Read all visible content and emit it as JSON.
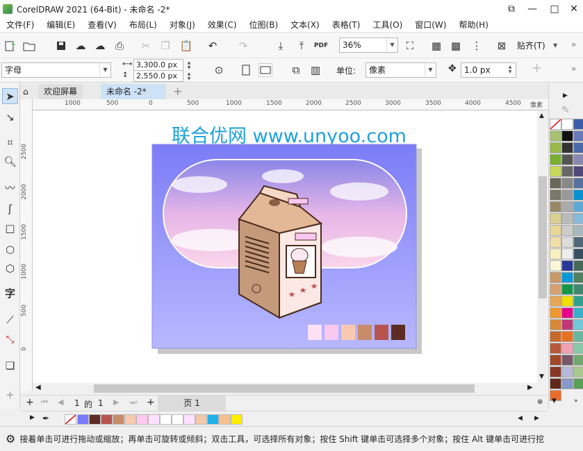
{
  "window": {
    "title": "CorelDRAW 2021 (64-Bit) - 未命名 -2*",
    "minimize": "—",
    "maximize": "□",
    "close": "✕",
    "restore": "⧉"
  },
  "menu": [
    "文件(F)",
    "编辑(E)",
    "查看(V)",
    "布局(L)",
    "对象(J)",
    "效果(C)",
    "位图(B)",
    "文本(X)",
    "表格(T)",
    "工具(O)",
    "窗口(W)",
    "帮助(H)"
  ],
  "toolbar": {
    "zoom": "36%",
    "pdf_label": "PDF",
    "snap_label": "贴齐(T)"
  },
  "propbar": {
    "object_type": "字母",
    "width": "3,300.0 px",
    "height": "2,550.0 px",
    "unit_label": "单位:",
    "unit_value": "像素",
    "nudge": "1.0 px"
  },
  "tabs": {
    "welcome": "欢迎屏幕",
    "doc": "未命名 -2*"
  },
  "ruler": {
    "h_labels": [
      "1000",
      "500",
      "0",
      "500",
      "1000",
      "1500",
      "2000",
      "2500",
      "3000",
      "3500",
      "4000",
      "4500"
    ],
    "unit": "像素",
    "v_labels": [
      "2500",
      "2000",
      "1500",
      "1000",
      "500",
      "0"
    ]
  },
  "canvas": {
    "watermark": "联合优网 www.unyoo.com"
  },
  "pagenav": {
    "current": "1",
    "of": "的",
    "total": "1",
    "page_tab": "页 1"
  },
  "doc_palette": [
    "#7b7bff",
    "#5c2d22",
    "#b85450",
    "#c88c6a",
    "#f8c8b0",
    "#ffc8f0",
    "#ffe0ff",
    "#ffffff",
    "#ffffff",
    "#ffe0ff",
    "#f0c8a8",
    "#20b0e8",
    "#f8c090",
    "#ffee00"
  ],
  "right_palette": [
    "#ffffff",
    "#3b5ca8",
    "#a8c070",
    "#111111",
    "#6878b8",
    "#98b848",
    "#333333",
    "#4868a8",
    "#78b030",
    "#555555",
    "#8888b0",
    "#c8d858",
    "#666666",
    "#504878",
    "#686858",
    "#888888",
    "#5870a0",
    "#787868",
    "#999999",
    "#0890d0",
    "#988868",
    "#aaaaaa",
    "#60a8d8",
    "#d8d090",
    "#bbbbbb",
    "#88b8d8",
    "#e8d898",
    "#cccccc",
    "#a8b8c0",
    "#f0e0a8",
    "#dddddd",
    "#506878",
    "#f8f0c0",
    "#eeeeee",
    "#385060",
    "#f8f8d8",
    "#283898",
    "#486858",
    "#c89868",
    "#0898d8",
    "#508060",
    "#d8a070",
    "#109848",
    "#408870",
    "#e8a858",
    "#f0e000",
    "#30a090",
    "#f09830",
    "#e8008a",
    "#38b0c8",
    "#d88838",
    "#c03878",
    "#70c8d8",
    "#c86828",
    "#e87020",
    "#68b8a0",
    "#b85838",
    "#f0a0b0",
    "#88c8a8",
    "#a04828",
    "#785868",
    "#70a870",
    "#883828",
    "#b8b8d8",
    "#a8c890",
    "#602818",
    "#8898c8",
    "#58a058",
    "#ec6c2c"
  ],
  "status": "接着单击可进行拖动或缩放；再单击可旋转或倾斜；双击工具，可选择所有对象；按住 Shift 键单击可选择多个对象；按住 Alt 键单击可进行挖"
}
